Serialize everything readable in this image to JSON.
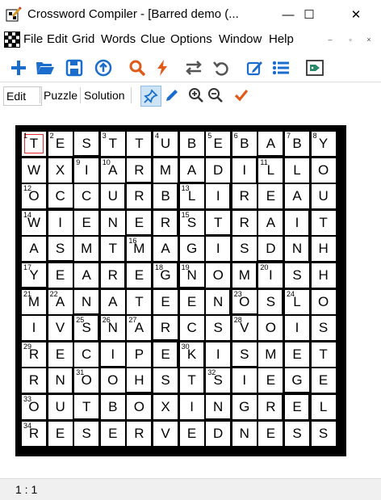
{
  "window": {
    "title": "Crossword Compiler - [Barred demo (...",
    "minimize": "—",
    "maximize": "☐",
    "close": "✕"
  },
  "menu": {
    "items": [
      "File",
      "Edit",
      "Grid",
      "Words",
      "Clue",
      "Options",
      "Window",
      "Help"
    ],
    "mdi": [
      "–",
      "▫",
      "×"
    ]
  },
  "toolbar": {
    "icons": [
      "add-icon",
      "open-folder-icon",
      "save-icon",
      "upload-icon",
      "search-icon",
      "lightning-icon",
      "swap-icon",
      "undo-icon",
      "edit-clue-icon",
      "list-icon",
      "tag-icon"
    ]
  },
  "modebar": {
    "edit": "Edit",
    "puzzle": "Puzzle",
    "solution": "Solution"
  },
  "grid": {
    "rows": [
      "TESTTUBEBABY",
      "WXIARMADILLO",
      "OCCURBLIREAU",
      "WIENERSTRAIT",
      "ASMTMAGISDNH",
      "YEAREGNOMISH",
      "MANATEENOSLO",
      "IVSNARCSVOIS",
      "RECIPEKISMET",
      "RNOOHSTSIEGE",
      "OUTBOXINGREL",
      "RESERVEDNESS"
    ],
    "numbers": [
      {
        "r": 0,
        "c": 0,
        "n": "1"
      },
      {
        "r": 0,
        "c": 1,
        "n": "2"
      },
      {
        "r": 0,
        "c": 3,
        "n": "3"
      },
      {
        "r": 0,
        "c": 5,
        "n": "4"
      },
      {
        "r": 0,
        "c": 7,
        "n": "5"
      },
      {
        "r": 0,
        "c": 8,
        "n": "6"
      },
      {
        "r": 0,
        "c": 10,
        "n": "7"
      },
      {
        "r": 0,
        "c": 11,
        "n": "8"
      },
      {
        "r": 1,
        "c": 2,
        "n": "9"
      },
      {
        "r": 1,
        "c": 3,
        "n": "10"
      },
      {
        "r": 1,
        "c": 9,
        "n": "11"
      },
      {
        "r": 2,
        "c": 0,
        "n": "12"
      },
      {
        "r": 2,
        "c": 6,
        "n": "13"
      },
      {
        "r": 3,
        "c": 0,
        "n": "14"
      },
      {
        "r": 3,
        "c": 6,
        "n": "15"
      },
      {
        "r": 4,
        "c": 4,
        "n": "16"
      },
      {
        "r": 5,
        "c": 0,
        "n": "17"
      },
      {
        "r": 5,
        "c": 5,
        "n": "18"
      },
      {
        "r": 5,
        "c": 6,
        "n": "19"
      },
      {
        "r": 5,
        "c": 9,
        "n": "20"
      },
      {
        "r": 6,
        "c": 0,
        "n": "21"
      },
      {
        "r": 6,
        "c": 1,
        "n": "22"
      },
      {
        "r": 6,
        "c": 8,
        "n": "23"
      },
      {
        "r": 6,
        "c": 10,
        "n": "24"
      },
      {
        "r": 7,
        "c": 2,
        "n": "25"
      },
      {
        "r": 7,
        "c": 3,
        "n": "26"
      },
      {
        "r": 7,
        "c": 4,
        "n": "27"
      },
      {
        "r": 7,
        "c": 8,
        "n": "28"
      },
      {
        "r": 8,
        "c": 0,
        "n": "29"
      },
      {
        "r": 8,
        "c": 6,
        "n": "30"
      },
      {
        "r": 9,
        "c": 2,
        "n": "31"
      },
      {
        "r": 9,
        "c": 7,
        "n": "32"
      },
      {
        "r": 10,
        "c": 0,
        "n": "33"
      },
      {
        "r": 11,
        "c": 0,
        "n": "34"
      }
    ],
    "bars_right": [
      [
        1,
        1
      ],
      [
        1,
        8
      ],
      [
        2,
        3
      ],
      [
        2,
        5
      ],
      [
        2,
        7
      ],
      [
        3,
        5
      ],
      [
        3,
        10
      ],
      [
        4,
        3
      ],
      [
        4,
        10
      ],
      [
        5,
        3
      ],
      [
        5,
        5
      ],
      [
        5,
        8
      ],
      [
        6,
        7
      ],
      [
        6,
        9
      ],
      [
        7,
        1
      ],
      [
        7,
        2
      ],
      [
        8,
        5
      ],
      [
        8,
        6
      ],
      [
        9,
        1
      ],
      [
        9,
        6
      ],
      [
        10,
        9
      ],
      [
        10,
        10
      ]
    ],
    "bars_bottom": [
      [
        0,
        2
      ],
      [
        0,
        9
      ],
      [
        1,
        4
      ],
      [
        1,
        6
      ],
      [
        2,
        1
      ],
      [
        3,
        4
      ],
      [
        3,
        7
      ],
      [
        4,
        1
      ],
      [
        4,
        9
      ],
      [
        5,
        0
      ],
      [
        5,
        6
      ],
      [
        6,
        2
      ],
      [
        6,
        8
      ],
      [
        7,
        5
      ],
      [
        8,
        3
      ],
      [
        8,
        8
      ],
      [
        9,
        4
      ],
      [
        9,
        10
      ],
      [
        10,
        2
      ],
      [
        10,
        7
      ]
    ],
    "cursor_cell": [
      0,
      0
    ],
    "cursor_color": "#e03030"
  },
  "status": {
    "position": "1 : 1"
  }
}
